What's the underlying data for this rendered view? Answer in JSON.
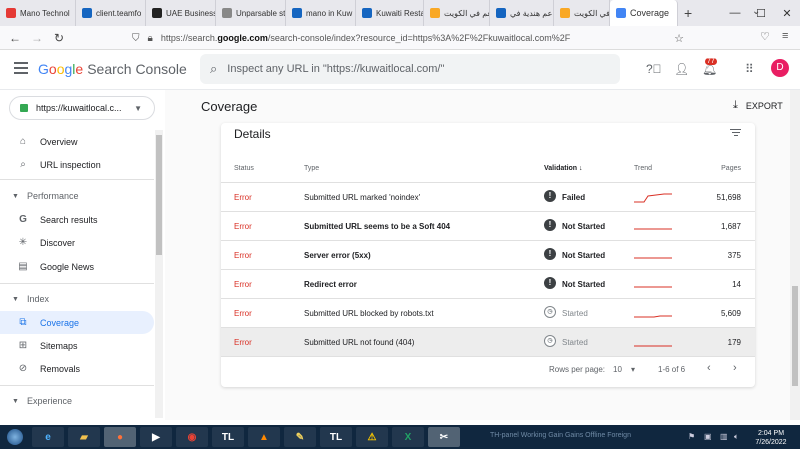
{
  "browser": {
    "tabs": [
      {
        "label": "Mano Technol",
        "color": "#e53935"
      },
      {
        "label": "client.teamfo",
        "color": "#1565c0"
      },
      {
        "label": "UAE Business",
        "color": "#222222"
      },
      {
        "label": "Unparsable st",
        "color": "#888888"
      },
      {
        "label": "mano in Kuw",
        "color": "#1565c0"
      },
      {
        "label": "Kuwaiti Resta",
        "color": "#1565c0"
      },
      {
        "label": "مطاعم في الكويت",
        "color": "#f9a825"
      },
      {
        "label": "مطاعم هندية في",
        "color": "#1565c0"
      },
      {
        "label": "مطاعم في الكويت",
        "color": "#f9a825"
      }
    ],
    "active_tab": {
      "label": "Coverage",
      "close": "×"
    },
    "new_tab": "+",
    "url_prefix": "https://search.",
    "url_domain": "google.com",
    "url_rest": "/search-console/index?resource_id=https%3A%2F%2Fkuwaitlocal.com%2F",
    "window_controls": [
      "—",
      "☐",
      "✕"
    ]
  },
  "gsc": {
    "logo_letters": [
      "G",
      "o",
      "o",
      "g",
      "l",
      "e"
    ],
    "product": "Search Console",
    "search_placeholder": "Inspect any URL in \"https://kuwaitlocal.com/\"",
    "notifications": "77",
    "avatar": "D"
  },
  "sidebar": {
    "property": "https://kuwaitlocal.c...",
    "overview": "Overview",
    "url_inspection": "URL inspection",
    "performance": "Performance",
    "search_results": "Search results",
    "discover": "Discover",
    "google_news": "Google News",
    "index": "Index",
    "coverage": "Coverage",
    "sitemaps": "Sitemaps",
    "removals": "Removals",
    "experience": "Experience"
  },
  "main": {
    "title": "Coverage",
    "export": "EXPORT",
    "details": "Details",
    "headers": {
      "status": "Status",
      "type": "Type",
      "validation": "Validation ↓",
      "trend": "Trend",
      "pages": "Pages"
    },
    "rows": [
      {
        "status": "Error",
        "type": "Submitted URL marked 'noindex'",
        "validation": "Failed",
        "pages": "51,698"
      },
      {
        "status": "Error",
        "type": "Submitted URL seems to be a Soft 404",
        "validation": "Not Started",
        "pages": "1,687"
      },
      {
        "status": "Error",
        "type": "Server error (5xx)",
        "validation": "Not Started",
        "pages": "375"
      },
      {
        "status": "Error",
        "type": "Redirect error",
        "validation": "Not Started",
        "pages": "14"
      },
      {
        "status": "Error",
        "type": "Submitted URL blocked by robots.txt",
        "validation": "Started",
        "pages": "5,609"
      },
      {
        "status": "Error",
        "type": "Submitted URL not found (404)",
        "validation": "Started",
        "pages": "179"
      }
    ],
    "pager": {
      "rows_per_page": "Rows per page:",
      "value": "10",
      "range": "1-6 of 6"
    }
  },
  "taskbar": {
    "tray_text": "TH-panel   Working   Gain Gains   Offline   Foreign",
    "time": "2:04 PM",
    "date": "7/26/2022"
  },
  "colors": {
    "error_red": "#d93025",
    "accent_blue": "#1a73e8",
    "trend_line": "#d93025"
  }
}
